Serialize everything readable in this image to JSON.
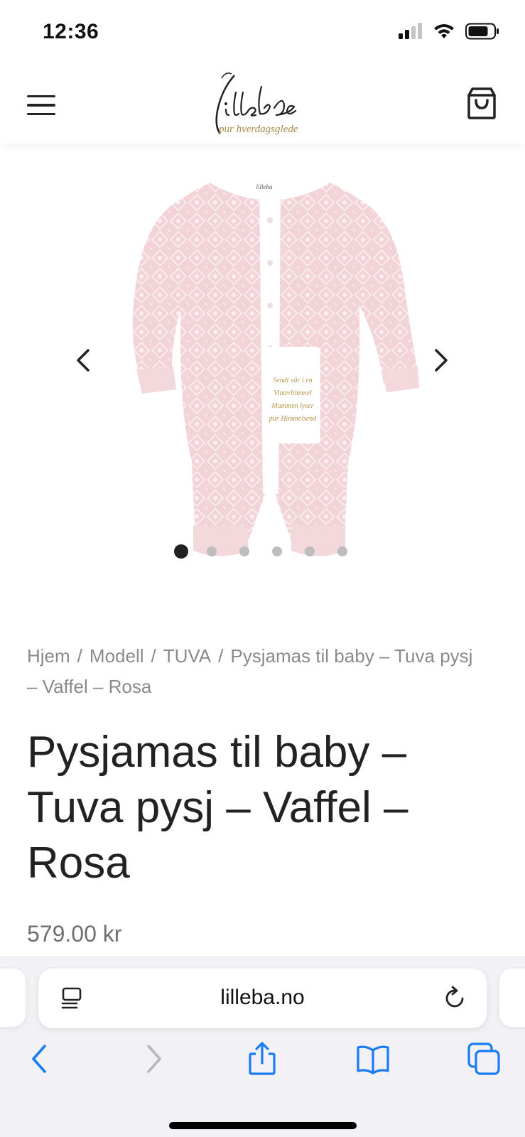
{
  "status_bar": {
    "time": "12:36",
    "icons": [
      "signal-icon",
      "wifi-icon",
      "battery-icon"
    ]
  },
  "header": {
    "logo_script": "lilleba",
    "logo_tagline": "pur hverdagsglede",
    "menu_icon": "hamburger-menu-icon",
    "cart_icon": "shopping-bag-icon"
  },
  "gallery": {
    "image_alt": "pink patterned baby sleepsuit with white front placket and pocket",
    "pocket_text": "Sendt vår i en Vinterhimmel Mammen lyser pur Himmelsend",
    "slide_count": 6,
    "active_slide": 1
  },
  "breadcrumb": {
    "items": [
      "Hjem",
      "Modell",
      "TUVA",
      "Pysjamas til baby – Tuva pysj – Vaffel – Rosa"
    ],
    "separator": "/"
  },
  "product": {
    "title": "Pysjamas til baby – Tuva pysj – Vaffel – Rosa",
    "price": "579.00 kr"
  },
  "browser": {
    "url": "lilleba.no"
  },
  "colors": {
    "accent_blue": "#1a7cf5",
    "garment_pink": "#f1d3d8",
    "logo_gold": "#a8894a"
  }
}
